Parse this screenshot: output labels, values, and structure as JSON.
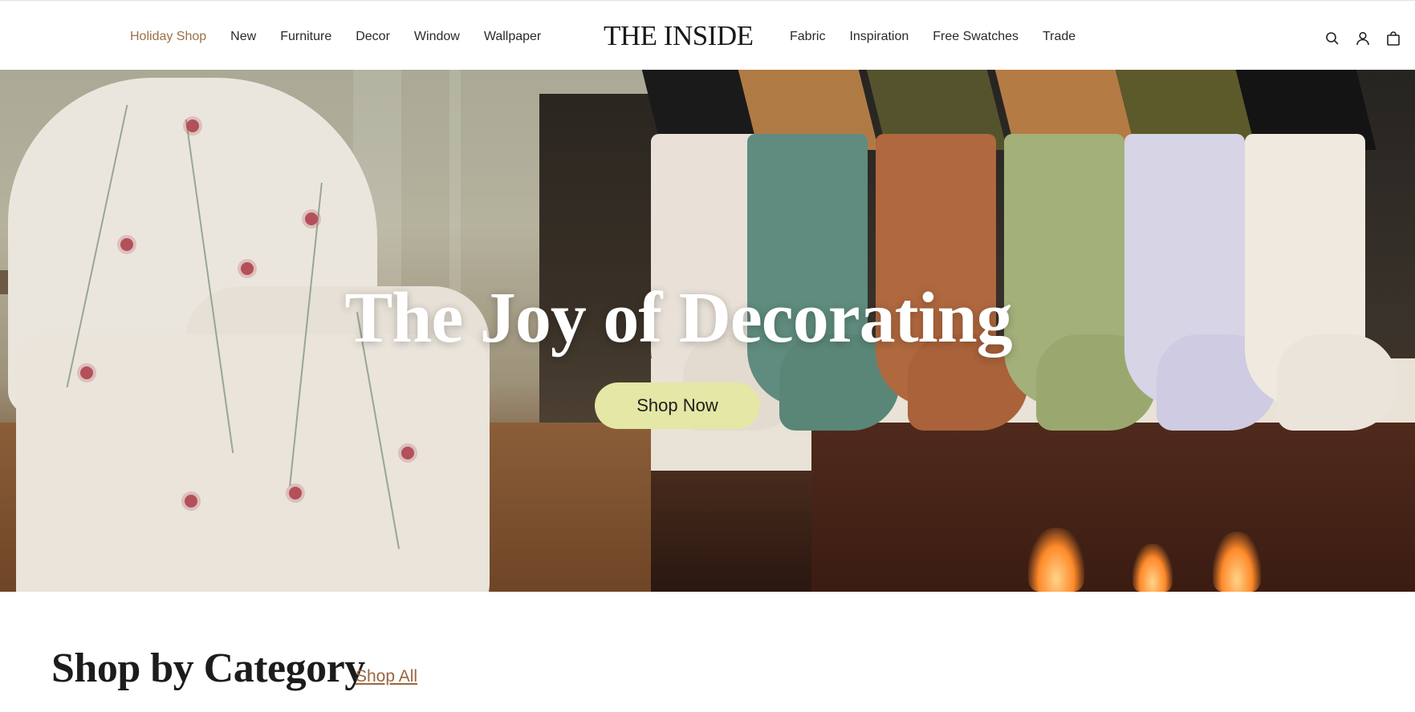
{
  "header": {
    "logo": "THE INSIDE",
    "nav_left": [
      {
        "label": "Holiday Shop",
        "active": true
      },
      {
        "label": "New"
      },
      {
        "label": "Furniture"
      },
      {
        "label": "Decor"
      },
      {
        "label": "Window"
      },
      {
        "label": "Wallpaper"
      }
    ],
    "nav_right": [
      {
        "label": "Fabric"
      },
      {
        "label": "Inspiration"
      },
      {
        "label": "Free Swatches"
      },
      {
        "label": "Trade"
      }
    ],
    "icons": [
      "search-icon",
      "account-icon",
      "cart-icon"
    ]
  },
  "hero": {
    "title": "The Joy of Decorating",
    "cta_label": "Shop Now"
  },
  "category_section": {
    "title": "Shop by Category",
    "link_label": "Shop All"
  },
  "colors": {
    "accent": "#9b7046",
    "cta_background": "#e4e7a5",
    "link": "#9b6640"
  }
}
